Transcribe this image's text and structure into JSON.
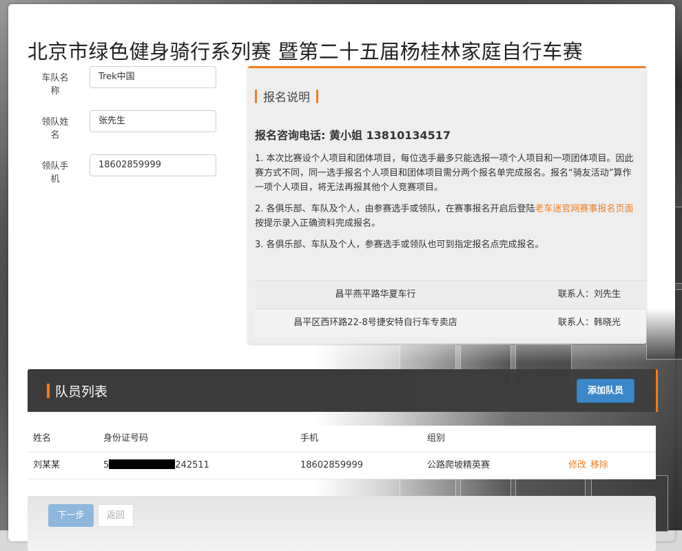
{
  "page": {
    "title": "北京市绿色健身骑行系列赛 暨第二十五届杨桂林家庭自行车赛"
  },
  "form": {
    "team_name_label": "车队名称",
    "team_name_value": "Trek中国",
    "leader_name_label": "领队姓名",
    "leader_name_value": "张先生",
    "leader_phone_label": "领队手机",
    "leader_phone_value": "18602859999"
  },
  "notice": {
    "heading": "报名说明",
    "phone_line": "报名咨询电话: 黄小姐 13810134517",
    "para1": "1. 本次比赛设个人项目和团体项目，每位选手最多只能选报一项个人项目和一项团体项目。因此赛方式不同，同一选手报名个人项目和团体项目需分两个报名单完成报名。报名“骑友活动”算作一项个人项目，将无法再报其他个人竞赛项目。",
    "para2_before": "2. 各俱乐部、车队及个人，由参赛选手或领队，在赛事报名开启后登陆",
    "para2_link": "老车迷官网赛事报名页面",
    "para2_after": "按提示录入正确资料完成报名。",
    "para3": "3. 各俱乐部、车队及个人，参赛选手或领队也可到指定报名点完成报名。",
    "shops": [
      {
        "name": "昌平燕平路华夏车行",
        "contact": "联系人：刘先生"
      },
      {
        "name": "昌平区西环路22-8号捷安特自行车专卖店",
        "contact": "联系人：韩晓光"
      }
    ]
  },
  "members": {
    "heading": "队员列表",
    "add_button": "添加队员",
    "columns": [
      "姓名",
      "身份证号码",
      "手机",
      "组别"
    ],
    "rows": [
      {
        "name": "刘某某",
        "id_prefix": "5",
        "id_suffix": "242511",
        "phone": "18602859999",
        "group": "公路爬坡精英赛",
        "edit": "修改",
        "remove": "移除"
      }
    ]
  },
  "footer": {
    "next_button": "下一步",
    "back_button": "返回"
  },
  "colors": {
    "accent": "#f07d1e",
    "primary_button": "#3a87c9",
    "bar_dark": "#3b3b3b"
  }
}
